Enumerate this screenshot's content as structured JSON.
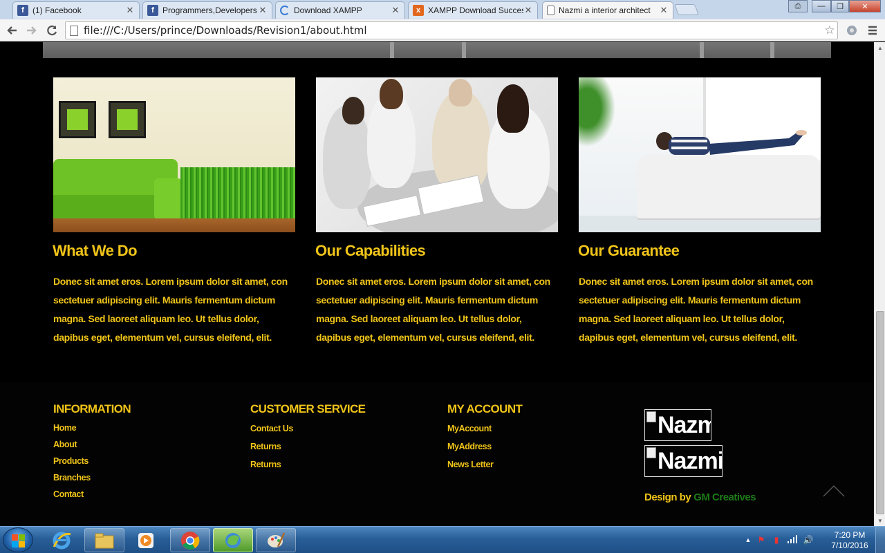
{
  "browser": {
    "tabs": [
      {
        "title": "(1) Facebook",
        "favicon": "facebook-icon",
        "favicon_color": "#3b5998",
        "active": false
      },
      {
        "title": "Programmers,Developers",
        "favicon": "facebook-icon",
        "favicon_color": "#3b5998",
        "active": false
      },
      {
        "title": "Download XAMPP",
        "favicon": "loading-icon",
        "favicon_color": "#3b7bd4",
        "active": false
      },
      {
        "title": "XAMPP Download Succes",
        "favicon": "xampp-icon",
        "favicon_color": "#e2681e",
        "active": false
      },
      {
        "title": "Nazmi a interior architect",
        "favicon": "page-icon",
        "favicon_color": "#ffffff",
        "active": true
      }
    ],
    "address": "file:///C:/Users/prince/Downloads/Revision1/about.html"
  },
  "features": [
    {
      "title": "What We Do",
      "text": "Donec sit amet eros. Lorem ipsum dolor sit amet, con sectetuer adipiscing elit. Mauris fermentum dictum magna. Sed laoreet aliquam leo. Ut tellus dolor, dapibus eget, elementum vel, cursus eleifend, elit.",
      "image": "green-sofa-room-image"
    },
    {
      "title": "Our Capabilities",
      "text": "Donec sit amet eros. Lorem ipsum dolor sit amet, con sectetuer adipiscing elit. Mauris fermentum dictum magna. Sed laoreet aliquam leo. Ut tellus dolor, dapibus eget, elementum vel, cursus eleifend, elit.",
      "image": "business-meeting-image"
    },
    {
      "title": "Our Guarantee",
      "text": "Donec sit amet eros. Lorem ipsum dolor sit amet, con sectetuer adipiscing elit. Mauris fermentum dictum magna. Sed laoreet aliquam leo. Ut tellus dolor, dapibus eget, elementum vel, cursus eleifend, elit.",
      "image": "woman-on-sofa-image"
    }
  ],
  "footer": {
    "information": {
      "heading": "INFORMATION",
      "links": [
        "Home",
        "About",
        "Products",
        "Branches",
        "Contact"
      ]
    },
    "customer_service": {
      "heading": "CUSTOMER SERVICE",
      "links": [
        "Contact Us",
        "Returns",
        "Returns"
      ]
    },
    "account": {
      "heading": "MY ACCOUNT",
      "links": [
        "MyAccount",
        "MyAddress",
        "News Letter"
      ]
    },
    "logos": [
      "Nazm",
      "Nazmi"
    ],
    "credit": {
      "prefix": "Design by",
      "name": "GM Creatives"
    }
  },
  "taskbar": {
    "time": "7:20 PM",
    "date": "7/10/2016"
  },
  "colors": {
    "accent_yellow": "#f0c419",
    "credit_green": "#1d7a18",
    "page_bg": "#000000"
  }
}
